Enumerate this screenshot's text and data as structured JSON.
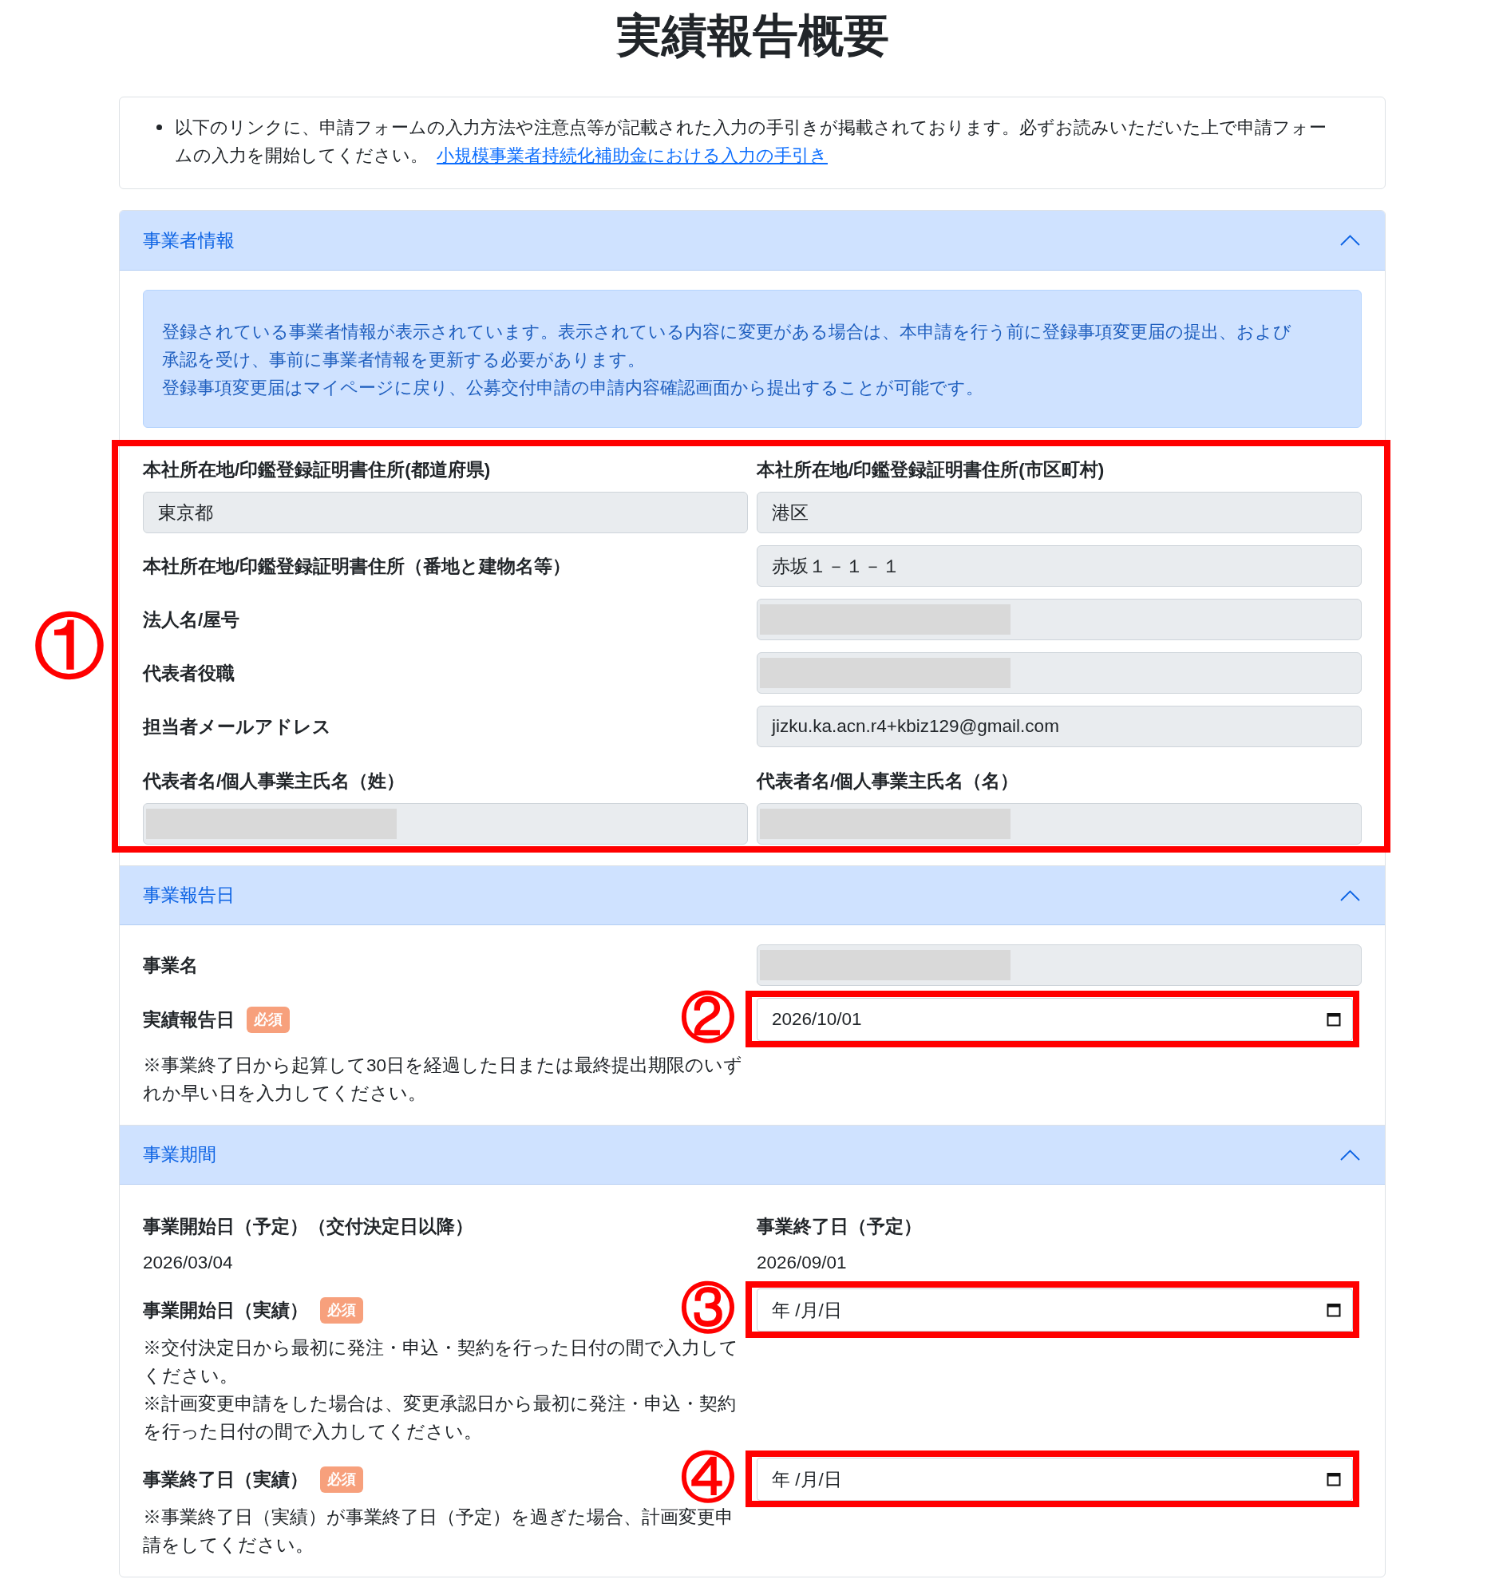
{
  "title": "実績報告概要",
  "notice": {
    "text": "以下のリンクに、申請フォームの入力方法や注意点等が記載された入力の手引きが掲載されております。必ずお読みいただいた上で申請フォームの入力を開始してください。",
    "link": "小規模事業者持続化補助金における入力の手引き"
  },
  "sections": [
    {
      "title": "事業者情報",
      "expanded": true,
      "content": [
        {
          "kind": "alert",
          "lines": [
            "登録されている事業者情報が表示されています。表示されている内容に変更がある場合は、本申請を行う前に登録事項変更届の提出、および承認を受け、事前に事業者情報を更新する必要があります。",
            "登録事項変更届はマイページに戻り、公募交付申請の申請内容確認画面から提出することが可能です。"
          ]
        },
        {
          "kind": "group",
          "marker": "①",
          "fields": [
            {
              "kind": "pair",
              "items": [
                {
                  "label": "本社所在地/印鑑登録証明書住所(都道府県)",
                  "value": "東京都",
                  "redacted": false
                },
                {
                  "label": "本社所在地/印鑑登録証明書住所(市区町村)",
                  "value": "港区",
                  "redacted": false
                }
              ]
            },
            {
              "kind": "row",
              "label": "本社所在地/印鑑登録証明書住所（番地と建物名等）",
              "value": "赤坂１－１－１",
              "redacted": false
            },
            {
              "kind": "row",
              "label": "法人名/屋号",
              "redacted": true
            },
            {
              "kind": "row",
              "label": "代表者役職",
              "redacted": true
            },
            {
              "kind": "row",
              "label": "担当者メールアドレス",
              "value": "jizku.ka.acn.r4+kbiz129@gmail.com",
              "redacted": false
            },
            {
              "kind": "pair",
              "items": [
                {
                  "label": "代表者名/個人事業主氏名（姓）",
                  "redacted": true
                },
                {
                  "label": "代表者名/個人事業主氏名（名）",
                  "redacted": true
                }
              ]
            }
          ]
        }
      ]
    },
    {
      "title": "事業報告日",
      "expanded": true,
      "content": [
        {
          "kind": "row",
          "label": "事業名",
          "redacted": true
        },
        {
          "kind": "date",
          "label": "実績報告日",
          "badge": "必須",
          "value": "2026/10/01",
          "marker": "②",
          "notes": [
            "※事業終了日から起算して30日を経過した日または最終提出期限のいずれか早い日を入力してください。"
          ]
        }
      ]
    },
    {
      "title": "事業期間",
      "expanded": true,
      "content": [
        {
          "kind": "info_pair",
          "items": [
            {
              "label": "事業開始日（予定）（交付決定日以降）",
              "value": "2026/03/04"
            },
            {
              "label": "事業終了日（予定）",
              "value": "2026/09/01"
            }
          ]
        },
        {
          "kind": "date",
          "label": "事業開始日（実績）",
          "badge": "必須",
          "placeholder": "年 /月/日",
          "marker": "③",
          "notes": [
            "※交付決定日から最初に発注・申込・契約を行った日付の間で入力してください。",
            "※計画変更申請をした場合は、変更承認日から最初に発注・申込・契約を行った日付の間で入力してください。"
          ]
        },
        {
          "kind": "date",
          "label": "事業終了日（実績）",
          "badge": "必須",
          "placeholder": "年 /月/日",
          "marker": "④",
          "notes": [
            "※事業終了日（実績）が事業終了日（予定）を過ぎた場合、計画変更申請をしてください。"
          ]
        }
      ]
    }
  ]
}
